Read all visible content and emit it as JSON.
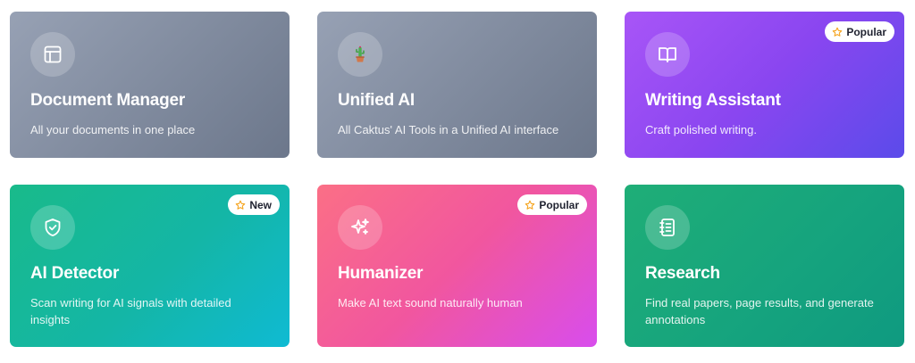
{
  "cards": [
    {
      "title": "Document Manager",
      "description": "All your documents in one place",
      "icon": "layout-icon",
      "gradient": [
        "#97a1b4",
        "#6c778b"
      ]
    },
    {
      "title": "Unified AI",
      "description": "All Caktus' AI Tools in a Unified AI interface",
      "icon": "cactus-icon",
      "gradient": [
        "#97a1b4",
        "#6c778b"
      ]
    },
    {
      "title": "Writing Assistant",
      "description": "Craft polished writing.",
      "icon": "open-book-icon",
      "badge": "Popular",
      "gradient": [
        "#a855f7",
        "#5b4bea"
      ]
    },
    {
      "title": "AI Detector",
      "description": "Scan writing for AI signals with detailed insights",
      "icon": "shield-check-icon",
      "badge": "New",
      "gradient": [
        "#19ba8a",
        "#0fbad3"
      ]
    },
    {
      "title": "Humanizer",
      "description": "Make AI text sound naturally human",
      "icon": "sparkles-icon",
      "badge": "Popular",
      "gradient": [
        "#fb6f86",
        "#d84ded"
      ]
    },
    {
      "title": "Research",
      "description": "Find real papers, page results, and generate annotations",
      "icon": "notebook-icon",
      "gradient": [
        "#1fae77",
        "#0f9a80"
      ]
    }
  ],
  "colors": {
    "badge_star": "#f5a623",
    "badge_bg": "#ffffff"
  }
}
